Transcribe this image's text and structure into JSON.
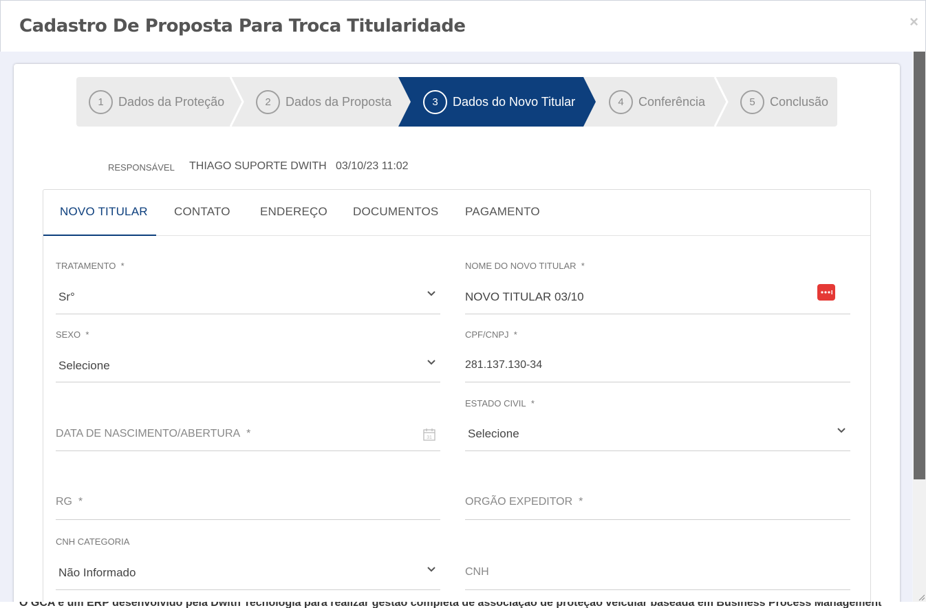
{
  "modal": {
    "title": "Cadastro De Proposta Para Troca Titularidade",
    "close_glyph": "×"
  },
  "stepper": {
    "steps": [
      {
        "num": "1",
        "label": "Dados da Proteção",
        "active": false
      },
      {
        "num": "2",
        "label": "Dados da Proposta",
        "active": false
      },
      {
        "num": "3",
        "label": "Dados do Novo Titular",
        "active": true
      },
      {
        "num": "4",
        "label": "Conferência",
        "active": false
      },
      {
        "num": "5",
        "label": "Conclusão",
        "active": false
      }
    ],
    "active_color": "#0d3f7d"
  },
  "responsavel": {
    "label": "RESPONSÁVEL",
    "name": "THIAGO SUPORTE DWITH",
    "datetime": "03/10/23 11:02"
  },
  "tabs": [
    {
      "label": "NOVO TITULAR",
      "active": true
    },
    {
      "label": "CONTATO",
      "active": false
    },
    {
      "label": "ENDEREÇO",
      "active": false
    },
    {
      "label": "DOCUMENTOS",
      "active": false
    },
    {
      "label": "PAGAMENTO",
      "active": false
    }
  ],
  "form": {
    "tratamento": {
      "label": "TRATAMENTO",
      "required": "*",
      "value": "Sr°"
    },
    "nome": {
      "label": "NOME DO NOVO TITULAR",
      "required": "*",
      "value": "NOVO TITULAR 03/10",
      "icon": "more-dots-icon"
    },
    "sexo": {
      "label": "SEXO",
      "required": "*",
      "value": "Selecione"
    },
    "cpf": {
      "label": "CPF/CNPJ",
      "required": "*",
      "value": "281.137.130-34"
    },
    "estado_civil": {
      "label": "ESTADO CIVIL",
      "required": "*",
      "value": "Selecione"
    },
    "nascimento": {
      "placeholder": "DATA DE NASCIMENTO/ABERTURA",
      "required": "*",
      "icon": "calendar-icon"
    },
    "rg": {
      "placeholder": "RG",
      "required": "*"
    },
    "orgao": {
      "placeholder": "ORGÃO EXPEDITOR",
      "required": "*"
    },
    "cnh_categoria": {
      "label": "CNH CATEGORIA",
      "value": "Não Informado"
    },
    "cnh": {
      "placeholder": "CNH"
    }
  },
  "footer": {
    "text": "O GCA é um ERP desenvolvido pela Dwith Tecnologia para realizar gestão completa de associação de proteção veicular baseada em Business Process Management"
  },
  "colors": {
    "accent": "#0d3f7d",
    "danger": "#e53935"
  }
}
